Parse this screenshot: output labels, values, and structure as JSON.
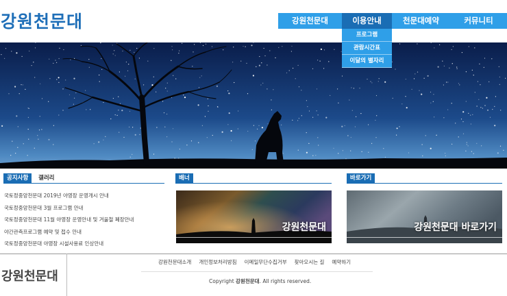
{
  "header": {
    "logo": "강원천문대",
    "nav": [
      {
        "label": "강원천문대",
        "active": false
      },
      {
        "label": "이용안내",
        "active": true
      },
      {
        "label": "천문대예약",
        "active": false
      },
      {
        "label": "커뮤니티",
        "active": false
      }
    ],
    "dropdown": [
      "프로그램",
      "관람시간표",
      "이달의 별자리"
    ]
  },
  "notice": {
    "tabs": [
      "공지사항",
      "갤러리"
    ],
    "items": [
      "국토정중앙천문대 2019년 야영장 운영개시 안내",
      "국토정중앙천문대 3월 프로그램 안내",
      "국토정중앙천문대 11월 야영장 운영안내 및 겨울철 폐장안내",
      "야간관측프로그램 예약 및 접수 안내",
      "국토정중앙천문대 야영장 시설사용료 인상안내"
    ]
  },
  "banner": {
    "tab": "배너",
    "text": "강원천문대"
  },
  "shortcut": {
    "tab": "바로가기",
    "text": "강원천문대 바로가기"
  },
  "footer": {
    "logo": "강원천문대",
    "links": [
      "강원천문대소개",
      "개인정보처리방침",
      "이메일무단수집거부",
      "찾아오시는 길",
      "예약하기"
    ],
    "copyright_prefix": "Copyright",
    "copyright_name": "강원천문대",
    "copyright_suffix": ". All rights reserved."
  },
  "colors": {
    "nav": "#2f9fe8",
    "nav_active": "#1a6db4",
    "logo": "#1f6fb8"
  }
}
